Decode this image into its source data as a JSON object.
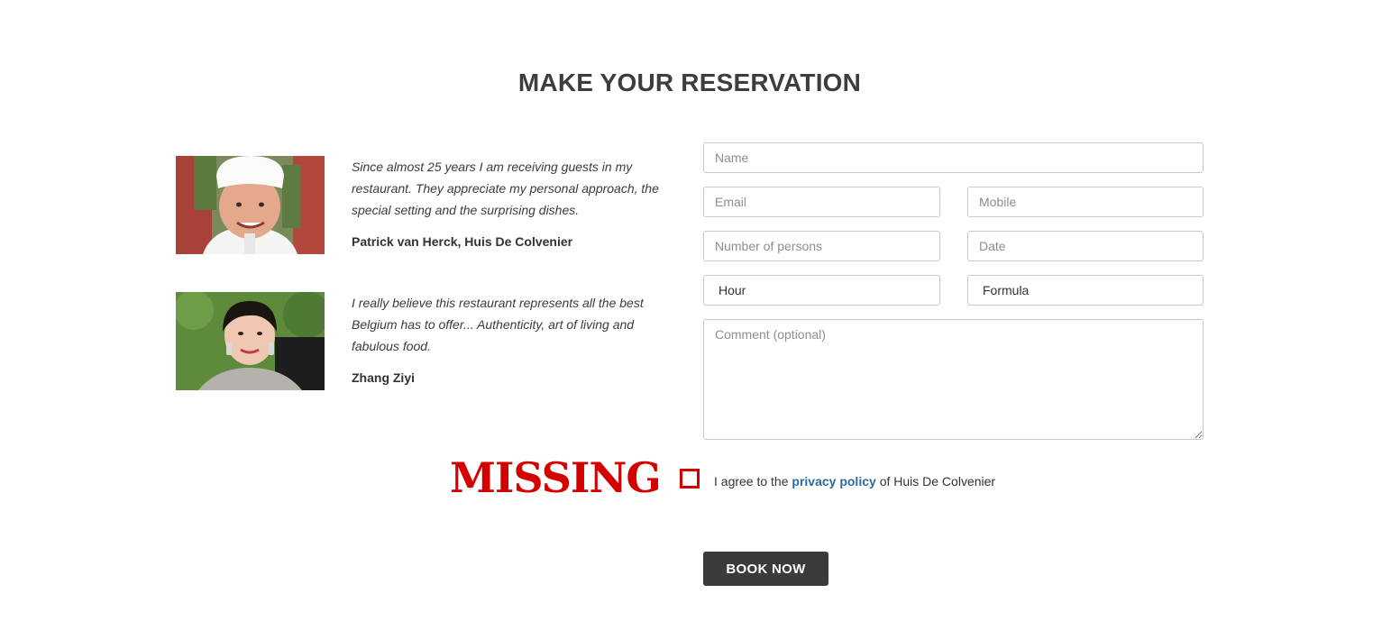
{
  "section": {
    "title": "MAKE YOUR RESERVATION"
  },
  "testimonials": [
    {
      "quote": "Since almost 25 years I am receiving guests in my restaurant. They appreciate my personal approach, the special setting and the surprising dishes.",
      "author": "Patrick van Herck, Huis De Colvenier",
      "photo_icon": "chef-portrait"
    },
    {
      "quote": "I really believe this restaurant represents all the best Belgium has to offer... Authenticity, art of living and fabulous food.",
      "author": "Zhang Ziyi",
      "photo_icon": "woman-portrait"
    }
  ],
  "form": {
    "name_placeholder": "Name",
    "email_placeholder": "Email",
    "mobile_placeholder": "Mobile",
    "persons_placeholder": "Number of persons",
    "date_placeholder": "Date",
    "hour_value": "Hour",
    "formula_value": "Formula",
    "comment_placeholder": "Comment (optional)",
    "missing_label": "MISSING",
    "agree_prefix": "I agree to the",
    "privacy_link": "privacy policy",
    "agree_suffix": "of Huis De Colvenier",
    "book_label": "BOOK NOW"
  },
  "colors": {
    "accent_dark": "#3c3a3b",
    "link": "#2c6aa0",
    "warning": "#d40000"
  }
}
